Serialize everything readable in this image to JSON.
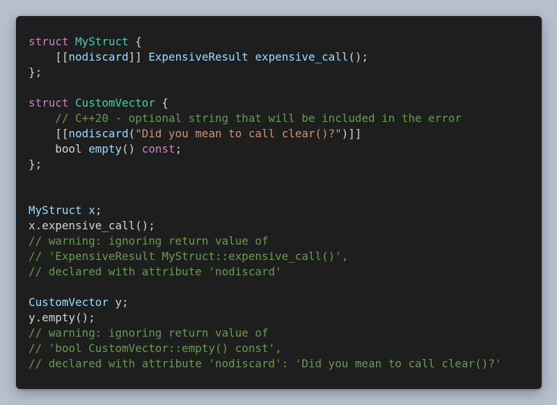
{
  "theme": {
    "background": "#b6c0cc",
    "editor_bg": "#1e1e1e",
    "keyword": "#c586c0",
    "type": "#4ec9b0",
    "identifier": "#9cdcfe",
    "function": "#dcdcaa",
    "string": "#ce9178",
    "comment": "#6a9955",
    "punctuation": "#d4d4d4",
    "bracket": "#ffd700"
  },
  "code": {
    "language": "C++",
    "lines": [
      [
        {
          "t": "struct",
          "c": "keyword"
        },
        {
          "t": " ",
          "c": "plain"
        },
        {
          "t": "MyStruct",
          "c": "type"
        },
        {
          "t": " {",
          "c": "plain"
        }
      ],
      [
        {
          "t": "    [[",
          "c": "plain"
        },
        {
          "t": "nodiscard",
          "c": "identifier"
        },
        {
          "t": "]] ",
          "c": "plain"
        },
        {
          "t": "ExpensiveResult",
          "c": "identifier"
        },
        {
          "t": " ",
          "c": "plain"
        },
        {
          "t": "expensive_call",
          "c": "identifier"
        },
        {
          "t": "();",
          "c": "plain"
        }
      ],
      [
        {
          "t": "};",
          "c": "plain"
        }
      ],
      [],
      [
        {
          "t": "struct",
          "c": "keyword"
        },
        {
          "t": " ",
          "c": "plain"
        },
        {
          "t": "CustomVector",
          "c": "type"
        },
        {
          "t": " {",
          "c": "plain"
        }
      ],
      [
        {
          "t": "    // C++20 - optional string that will be included in the error",
          "c": "comment"
        }
      ],
      [
        {
          "t": "    [[",
          "c": "plain"
        },
        {
          "t": "nodiscard",
          "c": "identifier"
        },
        {
          "t": "(",
          "c": "plain"
        },
        {
          "t": "\"Did you mean to call clear()?\"",
          "c": "string"
        },
        {
          "t": ")]]",
          "c": "plain"
        }
      ],
      [
        {
          "t": "    bool ",
          "c": "plain"
        },
        {
          "t": "empty",
          "c": "identifier"
        },
        {
          "t": "() ",
          "c": "plain"
        },
        {
          "t": "const",
          "c": "keyword"
        },
        {
          "t": ";",
          "c": "plain"
        }
      ],
      [
        {
          "t": "};",
          "c": "plain"
        }
      ],
      [],
      [],
      [
        {
          "t": "MyStruct",
          "c": "identifier"
        },
        {
          "t": " ",
          "c": "plain"
        },
        {
          "t": "x",
          "c": "identifier"
        },
        {
          "t": ";",
          "c": "plain"
        }
      ],
      [
        {
          "t": "x.expensive_call();",
          "c": "plain"
        }
      ],
      [
        {
          "t": "// warning: ignoring return value of",
          "c": "comment"
        }
      ],
      [
        {
          "t": "// 'ExpensiveResult MyStruct::expensive_call()',",
          "c": "comment"
        }
      ],
      [
        {
          "t": "// declared with attribute 'nodiscard'",
          "c": "comment"
        }
      ],
      [],
      [
        {
          "t": "CustomVector",
          "c": "identifier"
        },
        {
          "t": " ",
          "c": "plain"
        },
        {
          "t": "y",
          "c": "identifier"
        },
        {
          "t": ";",
          "c": "plain"
        }
      ],
      [
        {
          "t": "y.empty();",
          "c": "plain"
        }
      ],
      [
        {
          "t": "// warning: ignoring return value of",
          "c": "comment"
        }
      ],
      [
        {
          "t": "// 'bool CustomVector::empty() const',",
          "c": "comment"
        }
      ],
      [
        {
          "t": "// declared with attribute 'nodiscard': 'Did you mean to call clear()?'",
          "c": "comment"
        }
      ]
    ]
  }
}
